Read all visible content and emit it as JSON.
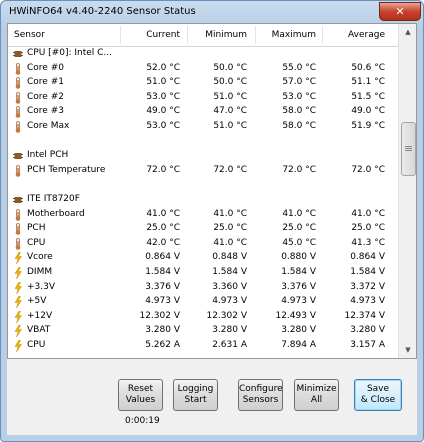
{
  "window": {
    "title": "HWiNFO64 v4.40-2240 Sensor Status",
    "close_label": "✕"
  },
  "columns": {
    "sensor": "Sensor",
    "current": "Current",
    "minimum": "Minimum",
    "maximum": "Maximum",
    "average": "Average"
  },
  "rows": [
    {
      "kind": "group",
      "icon": "chip-icon",
      "label": "CPU [#0]: Intel C..."
    },
    {
      "kind": "temp",
      "icon": "thermometer-icon",
      "label": "Core #0",
      "current": "52.0 °C",
      "minimum": "50.0 °C",
      "maximum": "55.0 °C",
      "average": "50.6 °C"
    },
    {
      "kind": "temp",
      "icon": "thermometer-icon",
      "label": "Core #1",
      "current": "51.0 °C",
      "minimum": "50.0 °C",
      "maximum": "57.0 °C",
      "average": "51.1 °C"
    },
    {
      "kind": "temp",
      "icon": "thermometer-icon",
      "label": "Core #2",
      "current": "53.0 °C",
      "minimum": "51.0 °C",
      "maximum": "53.0 °C",
      "average": "51.5 °C"
    },
    {
      "kind": "temp",
      "icon": "thermometer-icon",
      "label": "Core #3",
      "current": "49.0 °C",
      "minimum": "47.0 °C",
      "maximum": "58.0 °C",
      "average": "49.0 °C"
    },
    {
      "kind": "temp",
      "icon": "thermometer-icon",
      "label": "Core Max",
      "current": "53.0 °C",
      "minimum": "51.0 °C",
      "maximum": "58.0 °C",
      "average": "51.9 °C"
    },
    {
      "kind": "blank"
    },
    {
      "kind": "group",
      "icon": "chip-icon",
      "label": "Intel PCH"
    },
    {
      "kind": "temp",
      "icon": "thermometer-icon",
      "label": "PCH Temperature",
      "current": "72.0 °C",
      "minimum": "72.0 °C",
      "maximum": "72.0 °C",
      "average": "72.0 °C"
    },
    {
      "kind": "blank"
    },
    {
      "kind": "group",
      "icon": "chip-icon",
      "label": "ITE IT8720F"
    },
    {
      "kind": "temp",
      "icon": "thermometer-icon",
      "label": "Motherboard",
      "current": "41.0 °C",
      "minimum": "41.0 °C",
      "maximum": "41.0 °C",
      "average": "41.0 °C"
    },
    {
      "kind": "temp",
      "icon": "thermometer-icon",
      "label": "PCH",
      "current": "25.0 °C",
      "minimum": "25.0 °C",
      "maximum": "25.0 °C",
      "average": "25.0 °C"
    },
    {
      "kind": "temp",
      "icon": "thermometer-icon",
      "label": "CPU",
      "current": "42.0 °C",
      "minimum": "41.0 °C",
      "maximum": "45.0 °C",
      "average": "41.3 °C"
    },
    {
      "kind": "volt",
      "icon": "lightning-icon",
      "label": "Vcore",
      "current": "0.864 V",
      "minimum": "0.848 V",
      "maximum": "0.880 V",
      "average": "0.864 V"
    },
    {
      "kind": "volt",
      "icon": "lightning-icon",
      "label": "DIMM",
      "current": "1.584 V",
      "minimum": "1.584 V",
      "maximum": "1.584 V",
      "average": "1.584 V"
    },
    {
      "kind": "volt",
      "icon": "lightning-icon",
      "label": "+3.3V",
      "current": "3.376 V",
      "minimum": "3.360 V",
      "maximum": "3.376 V",
      "average": "3.372 V"
    },
    {
      "kind": "volt",
      "icon": "lightning-icon",
      "label": "+5V",
      "current": "4.973 V",
      "minimum": "4.973 V",
      "maximum": "4.973 V",
      "average": "4.973 V"
    },
    {
      "kind": "volt",
      "icon": "lightning-icon",
      "label": "+12V",
      "current": "12.302 V",
      "minimum": "12.302 V",
      "maximum": "12.493 V",
      "average": "12.374 V"
    },
    {
      "kind": "volt",
      "icon": "lightning-icon",
      "label": "VBAT",
      "current": "3.280 V",
      "minimum": "3.280 V",
      "maximum": "3.280 V",
      "average": "3.280 V"
    },
    {
      "kind": "volt",
      "icon": "lightning-icon",
      "label": "CPU",
      "current": "5.262 A",
      "minimum": "2.631 A",
      "maximum": "7.894 A",
      "average": "3.157 A"
    }
  ],
  "buttons": {
    "reset": {
      "line1": "Reset",
      "line2": "Values"
    },
    "logging": {
      "line1": "Logging",
      "line2": "Start"
    },
    "configure": {
      "line1": "Configure",
      "line2": "Sensors"
    },
    "minimize": {
      "line1": "Minimize",
      "line2": "All"
    },
    "save": {
      "line1": "Save",
      "line2": "& Close"
    }
  },
  "timer": "0:00:19",
  "colors": {
    "chip": "#8a5a2b",
    "thermo": "#c8763a",
    "lightning": "#f0b400"
  }
}
